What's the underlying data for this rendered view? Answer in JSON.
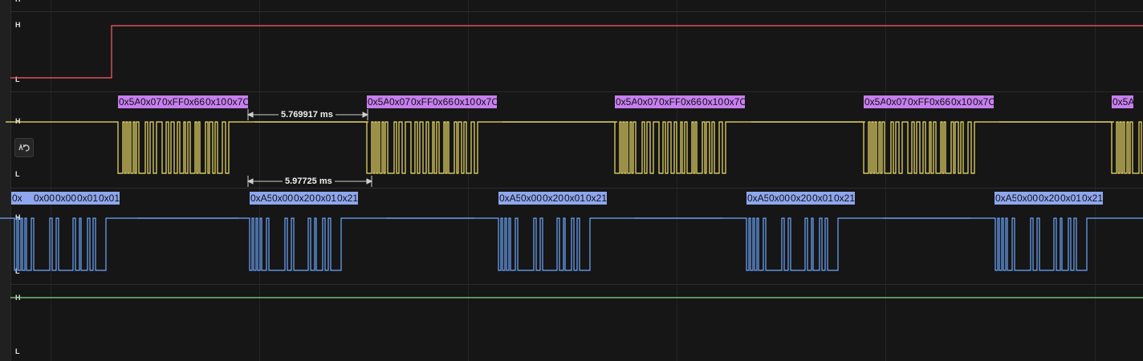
{
  "level_labels": {
    "high": "H",
    "low": "L"
  },
  "channel_colors": {
    "ch0": "#ff5c6c",
    "ch1": "#f3e26a",
    "ch2": "#6ea8ff",
    "ch3": "#7ee08a",
    "magenta_label": "#c77ff0",
    "blue_label": "#8fa7ef"
  },
  "channel1": {
    "frames": [
      [
        "0x5A",
        "0x07",
        "0xFF",
        "0x66",
        "0x10",
        "0x7C"
      ],
      [
        "0x5A",
        "0x07",
        "0xFF",
        "0x66",
        "0x10",
        "0x7C"
      ],
      [
        "0x5A",
        "0x07",
        "0xFF",
        "0x66",
        "0x10",
        "0x7C"
      ],
      [
        "0x5A",
        "0x07",
        "0xFF",
        "0x66",
        "0x10",
        "0x7C"
      ],
      [
        "0x5A"
      ]
    ],
    "measurement_upper": "5.769917 ms",
    "measurement_lower": "5.97725 ms"
  },
  "channel2": {
    "frames": [
      [
        "0x",
        "0x00",
        "0x00",
        "0x01",
        "0x01"
      ],
      [
        "0xA5",
        "0x00",
        "0x20",
        "0x01",
        "0x21"
      ],
      [
        "0xA5",
        "0x00",
        "0x20",
        "0x01",
        "0x21"
      ],
      [
        "0xA5",
        "0x00",
        "0x20",
        "0x01",
        "0x21"
      ],
      [
        "0xA5",
        "0x00",
        "0x20",
        "0x01",
        "0x21"
      ]
    ]
  },
  "icons": {
    "reset": "undo-wave-icon"
  }
}
